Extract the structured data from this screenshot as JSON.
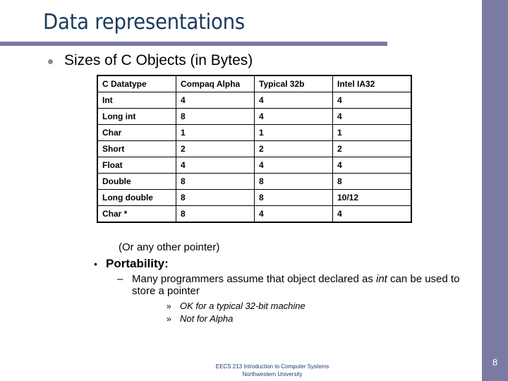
{
  "slide": {
    "title": "Data representations",
    "subtitle": "Sizes of C Objects (in Bytes)",
    "table": {
      "headers": [
        "C Datatype",
        "Compaq Alpha",
        "Typical 32b",
        "Intel IA32"
      ],
      "rows": [
        [
          "Int",
          "4",
          "4",
          "4"
        ],
        [
          "Long int",
          "8",
          "4",
          "4"
        ],
        [
          "Char",
          "1",
          "1",
          "1"
        ],
        [
          "Short",
          "2",
          "2",
          "2"
        ],
        [
          "Float",
          "4",
          "4",
          "4"
        ],
        [
          "Double",
          "8",
          "8",
          "8"
        ],
        [
          "Long double",
          "8",
          "8",
          "10/12"
        ],
        [
          "Char *",
          "8",
          "4",
          "4"
        ]
      ]
    },
    "note": "(Or any other pointer)",
    "bullet_dot": "•",
    "portability_label": "Portability:",
    "dash": "–",
    "portability_text_before": "Many programmers assume that object declared as ",
    "portability_text_em": "int",
    "portability_text_after": " can be used to store a pointer",
    "raquo": "»",
    "subpoints": [
      "OK for a typical 32-bit machine",
      "Not for Alpha"
    ],
    "footer_line1": "EECS 213 Introduction to Computer Systems",
    "footer_line2": "Northwestern University",
    "page_number": "8"
  }
}
